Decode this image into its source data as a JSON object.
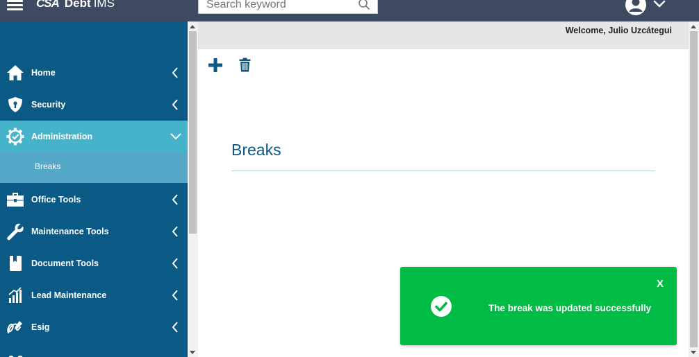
{
  "header": {
    "logo_mark": "CSA",
    "app_name_bold": "Debt",
    "app_name_rest": "IMS",
    "search": {
      "placeholder": "Search keyword",
      "value": ""
    },
    "user_menu": {
      "avatar_icon": "user-circle-icon",
      "chevron_icon": "chevron-down-icon"
    }
  },
  "sidebar": {
    "items": [
      {
        "label": "Home",
        "icon": "home-icon",
        "expanded": false
      },
      {
        "label": "Security",
        "icon": "shield-icon",
        "expanded": false
      },
      {
        "label": "Administration",
        "icon": "gear-check-icon",
        "expanded": true,
        "active": true
      },
      {
        "label": "Office Tools",
        "icon": "toolbox-icon",
        "expanded": false
      },
      {
        "label": "Maintenance Tools",
        "icon": "wrench-icon",
        "expanded": false
      },
      {
        "label": "Document Tools",
        "icon": "book-icon",
        "expanded": false
      },
      {
        "label": "Lead Maintenance",
        "icon": "bar-chart-icon",
        "expanded": false
      },
      {
        "label": "Esig",
        "icon": "signature-icon",
        "expanded": false
      }
    ],
    "sub_items": [
      {
        "label": "Breaks",
        "parent": "Administration"
      }
    ]
  },
  "main": {
    "welcome": "Welcome, Julio Uzcátegui",
    "toolbar": {
      "add_icon": "plus-icon",
      "delete_icon": "trash-icon"
    },
    "page_title": "Breaks"
  },
  "toast": {
    "message": "The break was updated successfully",
    "close_label": "X",
    "icon": "check-circle-icon"
  },
  "colors": {
    "topbar": "#3d4a62",
    "sidebar": "#0b5a86",
    "sidebar_active": "#47b3cb",
    "sidebar_sub": "#56a8c9",
    "toast": "#00bb44",
    "title": "#0b5a86"
  }
}
